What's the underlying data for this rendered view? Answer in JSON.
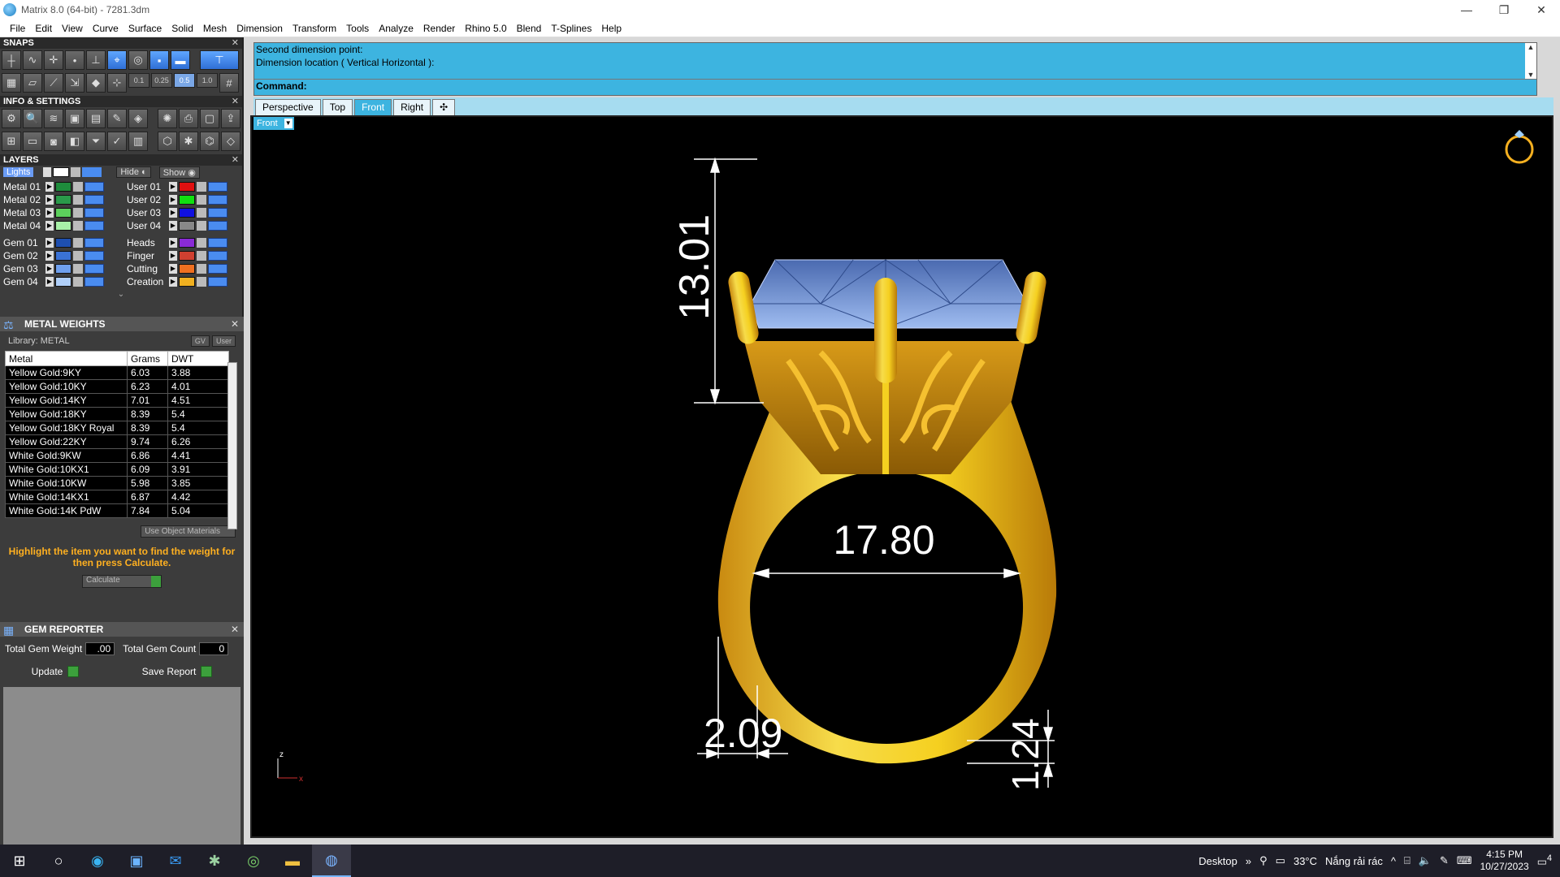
{
  "window": {
    "title": "Matrix 8.0 (64-bit) - 7281.3dm",
    "minimize": "—",
    "restore": "❐",
    "close": "✕"
  },
  "menu": [
    "File",
    "Edit",
    "View",
    "Curve",
    "Surface",
    "Solid",
    "Mesh",
    "Dimension",
    "Transform",
    "Tools",
    "Analyze",
    "Render",
    "Rhino 5.0",
    "Blend",
    "T-Splines",
    "Help"
  ],
  "snaps": {
    "title": "SNAPS",
    "increments": [
      "0.1",
      "0.25",
      "0.5",
      "1.0"
    ]
  },
  "info": {
    "title": "INFO & SETTINGS"
  },
  "layers": {
    "title": "LAYERS",
    "lights": "Lights",
    "hide": "Hide",
    "show": "Show",
    "left": [
      {
        "name": "Metal 01",
        "color": "#1e8c3c"
      },
      {
        "name": "Metal 02",
        "color": "#2a9a4a"
      },
      {
        "name": "Metal 03",
        "color": "#5cd05c"
      },
      {
        "name": "Metal 04",
        "color": "#a8f0a8"
      },
      {
        "name": "Gem 01",
        "color": "#1e4fb0"
      },
      {
        "name": "Gem 02",
        "color": "#3a72d6"
      },
      {
        "name": "Gem 03",
        "color": "#6fa0ee"
      },
      {
        "name": "Gem 04",
        "color": "#b0cff8"
      }
    ],
    "right": [
      {
        "name": "User 01",
        "color": "#e01010"
      },
      {
        "name": "User 02",
        "color": "#10e010"
      },
      {
        "name": "User 03",
        "color": "#1010e0"
      },
      {
        "name": "User 04",
        "color": "#888888"
      },
      {
        "name": "Heads",
        "color": "#8a2ad6"
      },
      {
        "name": "Finger",
        "color": "#d04030"
      },
      {
        "name": "Cutting",
        "color": "#f07020"
      },
      {
        "name": "Creation",
        "color": "#f0b020"
      }
    ]
  },
  "metal_weights": {
    "title": "METAL WEIGHTS",
    "library": "Library: METAL",
    "gv_toggle": "GV",
    "user_toggle": "User",
    "headers": [
      "Metal",
      "Grams",
      "DWT"
    ],
    "rows": [
      [
        "Yellow Gold:9KY",
        "6.03",
        "3.88"
      ],
      [
        "Yellow Gold:10KY",
        "6.23",
        "4.01"
      ],
      [
        "Yellow Gold:14KY",
        "7.01",
        "4.51"
      ],
      [
        "Yellow Gold:18KY",
        "8.39",
        "5.4"
      ],
      [
        "Yellow Gold:18KY Royal",
        "8.39",
        "5.4"
      ],
      [
        "Yellow Gold:22KY",
        "9.74",
        "6.26"
      ],
      [
        "White Gold:9KW",
        "6.86",
        "4.41"
      ],
      [
        "White Gold:10KX1",
        "6.09",
        "3.91"
      ],
      [
        "White Gold:10KW",
        "5.98",
        "3.85"
      ],
      [
        "White Gold:14KX1",
        "6.87",
        "4.42"
      ],
      [
        "White Gold:14K PdW",
        "7.84",
        "5.04"
      ]
    ],
    "use_object_materials": "Use Object Materials",
    "hint": "Highlight the item you want to find the weight for then press Calculate.",
    "calculate": "Calculate"
  },
  "gem_reporter": {
    "title": "GEM REPORTER",
    "total_weight_label": "Total Gem Weight",
    "total_weight_value": ".00",
    "total_count_label": "Total Gem Count",
    "total_count_value": "0",
    "update": "Update",
    "save_report": "Save Report"
  },
  "command": {
    "line1": "Second dimension point:",
    "line2": "Dimension location ( Vertical  Horizontal ):",
    "prompt": "Command:"
  },
  "viewport": {
    "tabs": [
      "Perspective",
      "Top",
      "Front",
      "Right"
    ],
    "active_tab": "Front",
    "view_label": "Front",
    "dimensions": {
      "height": "13.01",
      "inner_diameter": "17.80",
      "shank_width": "2.09",
      "shank_thickness": "1.24"
    },
    "axis_z": "z",
    "axis_x": "x",
    "colors": {
      "gold": "#f5d020",
      "gold_dark": "#c98a10",
      "gem": "#6a8fd0",
      "dimension": "#ffffff"
    }
  },
  "taskbar": {
    "desktop": "Desktop",
    "weather_temp": "33°C",
    "weather_text": "Nắng rải rác",
    "time": "4:15 PM",
    "date": "10/27/2023",
    "notifications": "4"
  }
}
